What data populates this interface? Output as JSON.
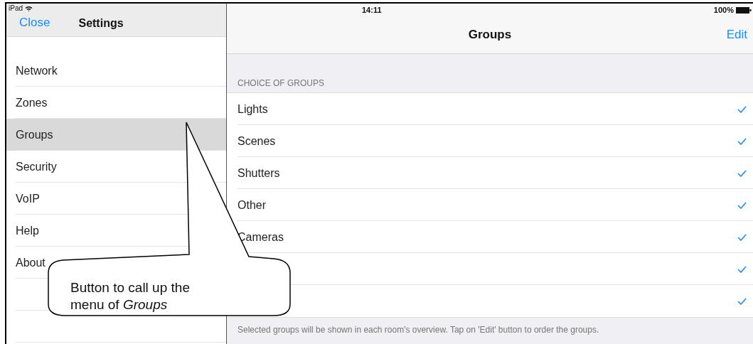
{
  "status_bar": {
    "device": "iPad",
    "time": "14:11",
    "battery": "100%"
  },
  "sidebar": {
    "close": "Close",
    "title": "Settings",
    "items": [
      {
        "label": "Network",
        "selected": false
      },
      {
        "label": "Zones",
        "selected": false
      },
      {
        "label": "Groups",
        "selected": true
      },
      {
        "label": "Security",
        "selected": false
      },
      {
        "label": "VoIP",
        "selected": false
      },
      {
        "label": "Help",
        "selected": false
      },
      {
        "label": "About",
        "selected": false
      },
      {
        "selected": false
      },
      {
        "selected": false
      }
    ]
  },
  "detail": {
    "title": "Groups",
    "edit": "Edit",
    "section_header": "CHOICE OF GROUPS",
    "rows": [
      {
        "label": "Lights",
        "checked": true
      },
      {
        "label": "Scenes",
        "checked": true
      },
      {
        "label": "Shutters",
        "checked": true
      },
      {
        "label": "Other",
        "checked": true
      },
      {
        "label": "Cameras",
        "checked": true
      },
      {
        "checked": true
      },
      {
        "checked": true
      }
    ],
    "footer": "Selected groups will be shown in each room's overview. Tap on 'Edit' button to order the groups."
  },
  "callout": {
    "text": "Button to call up the menu of *Groups*"
  }
}
